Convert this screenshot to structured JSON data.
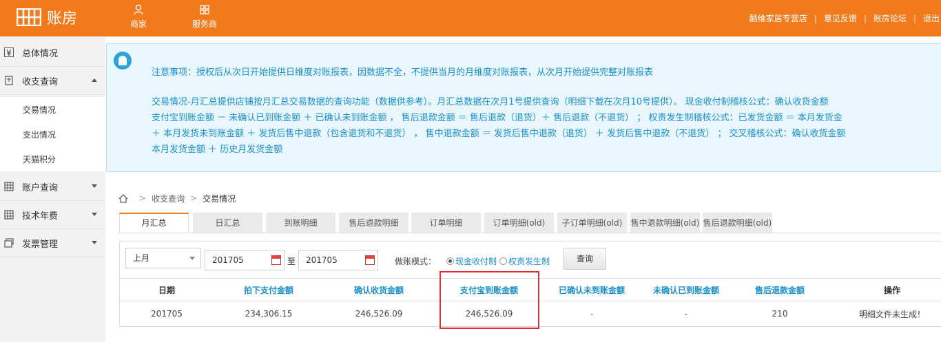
{
  "app": {
    "title": "账房"
  },
  "topnav": [
    {
      "label": "商家",
      "icon": "user-icon"
    },
    {
      "label": "服务商",
      "icon": "grid-icon"
    }
  ],
  "toplinks": {
    "shop": "酷维家居专营店",
    "feedback": "意见反馈",
    "forum": "账房论坛",
    "logout": "退出"
  },
  "sidebar": {
    "overview": "总体情况",
    "income": "收支查询",
    "sub_items": [
      "交易情况",
      "支出情况",
      "天猫积分"
    ],
    "account": "账户查询",
    "tech_fee": "技术年费",
    "invoice": "发票管理"
  },
  "notice": {
    "line1": "注意事项：授权后从次日开始提供日维度对账报表，因数据不全，不提供当月的月维度对账报表，从次月开始提供完整对账报表",
    "line2": "交易情况-月汇总提供店铺按月汇总交易数据的查询功能（数据供参考）。月汇总数据在次月1号提供查询（明细下载在次月10号提供）。  现金收付制稽核公式：确认收货金额",
    "line3": "支付宝到账金额  －  未确认已到账金额  ＋  已确认未到账金额 ，  售后退款金额  ＝  售后退款（退货）＋  售后退款（不退货）  ；  权责发生制稽核公式：已发货金额  ＝  本月发货金",
    "line4": "＋  本月发货未到账金额  ＋  发货后售中退款（包含退货和不退货）  ，  售中退款金额  ＝  发货后售中退款（退货）  ＋  发货后售中退款（不退货）  ；  交叉稽核公式：确认收货金额",
    "line5": "本月发货金额  ＋  历史月发货金额"
  },
  "breadcrumb": [
    "收支查询",
    "交易情况"
  ],
  "tabs": [
    "月汇总",
    "日汇总",
    "到账明细",
    "售后退款明细",
    "订单明细",
    "订单明细(old)",
    "子订单明细(old)",
    "售中退款明细(old)",
    "售后退款明细(old)"
  ],
  "filter": {
    "period": "上月",
    "date_from": "201705",
    "to_label": "至",
    "date_to": "201705",
    "mode_label": "做账模式：",
    "mode_cash": "现金收付制",
    "mode_accrual": "权责发生制",
    "query_button": "查询"
  },
  "table": {
    "headers": [
      "日期",
      "拍下支付金额",
      "确认收货金额",
      "支付宝到账金额",
      "已确认未到账金额",
      "未确认已到账金额",
      "售后退款金额",
      "操作"
    ],
    "rows": [
      [
        "201705",
        "234,306.15",
        "246,526.09",
        "246,526.09",
        "-",
        "-",
        "210",
        "明细文件未生成！"
      ]
    ]
  },
  "colors": {
    "brand": "#f27a1a",
    "link": "#1a8fcc",
    "notice_bg": "#e9f6fc",
    "highlight": "#e53333"
  }
}
